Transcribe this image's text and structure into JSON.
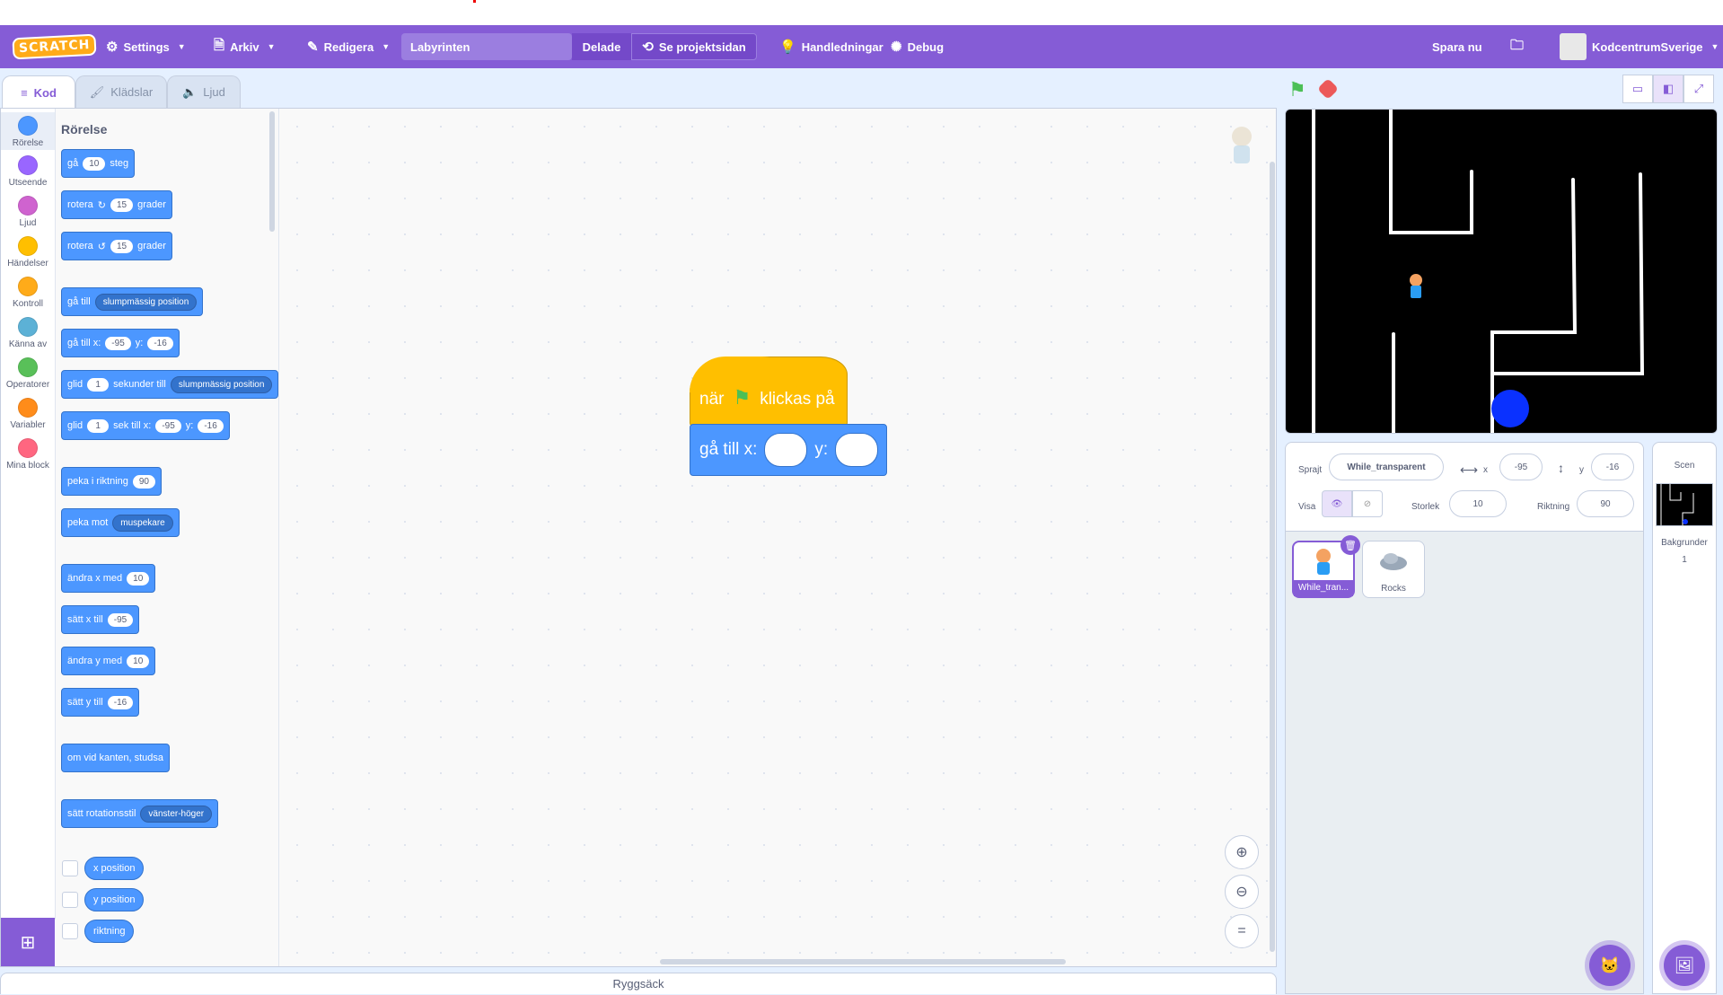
{
  "menubar": {
    "logo": "SCRATCH",
    "settings": "Settings",
    "file": "Arkiv",
    "edit": "Redigera",
    "project_title": "Labyrinten",
    "shared": "Delade",
    "see_project_page": "Se projektsidan",
    "tutorials": "Handledningar",
    "debug": "Debug",
    "save_now": "Spara nu",
    "username": "KodcentrumSverige"
  },
  "tabs": {
    "code": "Kod",
    "costumes": "Klädslar",
    "sounds": "Ljud"
  },
  "categories": [
    {
      "label": "Rörelse",
      "color": "#4c97ff"
    },
    {
      "label": "Utseende",
      "color": "#9966ff"
    },
    {
      "label": "Ljud",
      "color": "#cf63cf"
    },
    {
      "label": "Händelser",
      "color": "#ffbf00"
    },
    {
      "label": "Kontroll",
      "color": "#ffab19"
    },
    {
      "label": "Känna av",
      "color": "#5cb1d6"
    },
    {
      "label": "Operatorer",
      "color": "#59c059"
    },
    {
      "label": "Variabler",
      "color": "#ff8c1a"
    },
    {
      "label": "Mina block",
      "color": "#ff6680"
    }
  ],
  "palette": {
    "title": "Rörelse",
    "move": {
      "a": "gå",
      "v": "10",
      "b": "steg"
    },
    "turn_right": {
      "a": "rotera",
      "v": "15",
      "b": "grader"
    },
    "turn_left": {
      "a": "rotera",
      "v": "15",
      "b": "grader"
    },
    "goto_random": {
      "a": "gå till",
      "dd": "slumpmässig position"
    },
    "goto_xy": {
      "a": "gå till x:",
      "x": "-95",
      "b": "y:",
      "y": "-16"
    },
    "glide_random": {
      "a": "glid",
      "v": "1",
      "b": "sekunder till",
      "dd": "slumpmässig position"
    },
    "glide_xy": {
      "a": "glid",
      "v": "1",
      "b": "sek till x:",
      "x": "-95",
      "c": "y:",
      "y": "-16"
    },
    "point_dir": {
      "a": "peka i riktning",
      "v": "90"
    },
    "point_towards": {
      "a": "peka mot",
      "dd": "muspekare"
    },
    "change_x": {
      "a": "ändra x med",
      "v": "10"
    },
    "set_x": {
      "a": "sätt x till",
      "v": "-95"
    },
    "change_y": {
      "a": "ändra y med",
      "v": "10"
    },
    "set_y": {
      "a": "sätt y till",
      "v": "-16"
    },
    "bounce": "om vid kanten, studsa",
    "rotation_style": {
      "a": "sätt rotationsstil",
      "dd": "vänster-höger"
    },
    "x_position": "x position",
    "y_position": "y position",
    "direction": "riktning"
  },
  "script": {
    "hat_a": "när",
    "hat_b": "klickas på",
    "goto_a": "gå till x:",
    "goto_b": "y:"
  },
  "backpack": "Ryggsäck",
  "sprite_info": {
    "sprite_label": "Sprajt",
    "sprite_name": "While_transparent",
    "x_label": "x",
    "x": "-95",
    "y_label": "y",
    "y": "-16",
    "show_label": "Visa",
    "size_label": "Storlek",
    "size": "10",
    "direction_label": "Riktning",
    "direction": "90"
  },
  "sprites": [
    {
      "name": "While_tran..."
    },
    {
      "name": "Rocks"
    }
  ],
  "scene": {
    "title": "Scen",
    "backdrops_label": "Bakgrunder",
    "backdrops_count": "1"
  },
  "colors": {
    "accent": "#855cd6",
    "motion": "#4c97ff",
    "events": "#ffbf00"
  }
}
